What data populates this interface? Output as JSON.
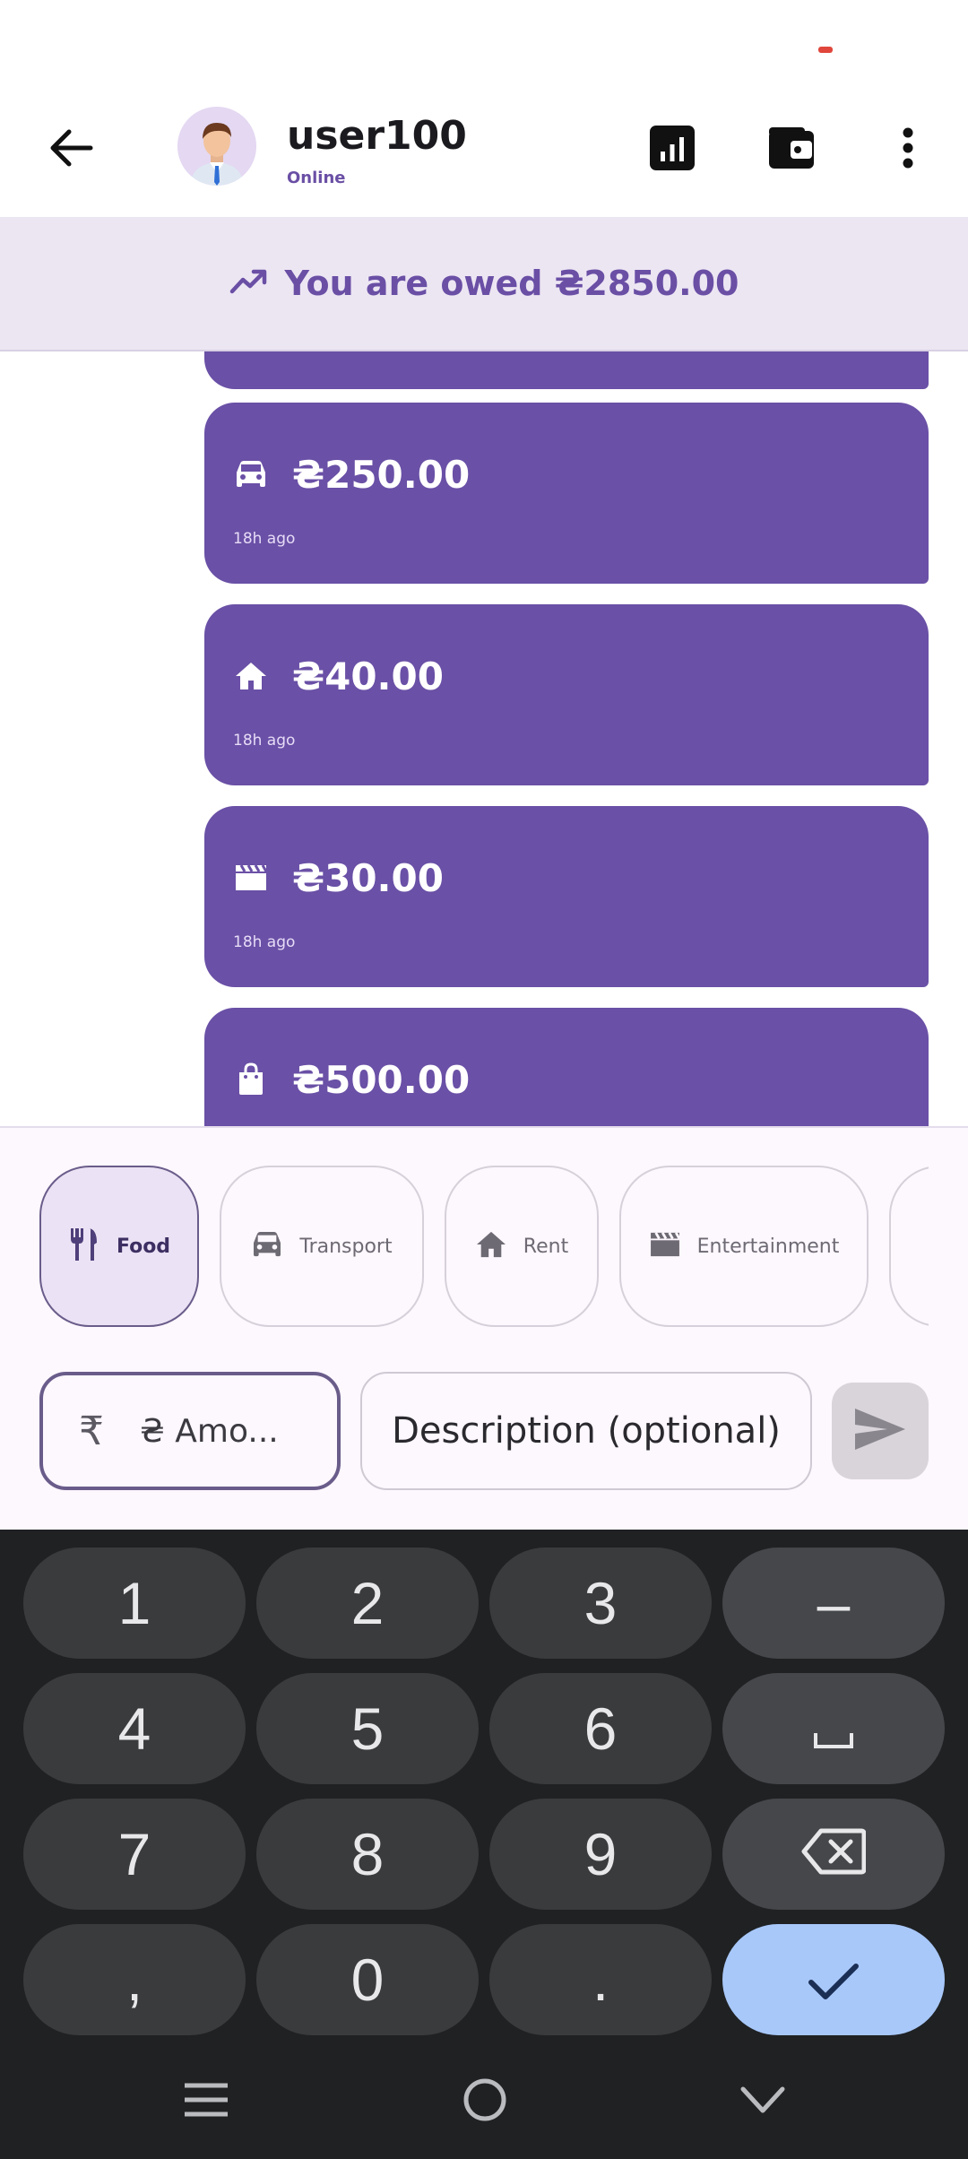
{
  "header": {
    "username": "user100",
    "status": "Online"
  },
  "banner": {
    "text": "You are owed ₴2850.00"
  },
  "messages": [
    {
      "amount": "",
      "time": "",
      "icon": "partial-bubble-icon"
    },
    {
      "amount": "₴250.00",
      "time": "18h ago",
      "icon": "car-icon"
    },
    {
      "amount": "₴40.00",
      "time": "18h ago",
      "icon": "home-icon"
    },
    {
      "amount": "₴30.00",
      "time": "18h ago",
      "icon": "movie-clapper-icon"
    },
    {
      "amount": "₴500.00",
      "time": "",
      "icon": "shopping-bag-icon"
    }
  ],
  "categories": [
    {
      "label": "Food",
      "icon": "restaurant-icon",
      "selected": true
    },
    {
      "label": "Transport",
      "icon": "car-icon",
      "selected": false
    },
    {
      "label": "Rent",
      "icon": "home-icon",
      "selected": false
    },
    {
      "label": "Entertainment",
      "icon": "movie-clapper-icon",
      "selected": false
    }
  ],
  "input": {
    "currency_symbol": "₹",
    "amount_placeholder": "₴ Amo...",
    "description_placeholder": "Description (optional)"
  },
  "keyboard": {
    "keys": [
      "1",
      "2",
      "3",
      "–",
      "4",
      "5",
      "6",
      "␣",
      "7",
      "8",
      "9",
      "backspace",
      ",",
      "0",
      ".",
      "done"
    ]
  },
  "colors": {
    "primary": "#6a50a6",
    "banner_bg": "#ece6f3",
    "panel_bg": "#fdf7fe",
    "keyboard_bg": "#1f2123",
    "key_bg": "#3a3b3d",
    "done_key": "#a8c8fa"
  }
}
